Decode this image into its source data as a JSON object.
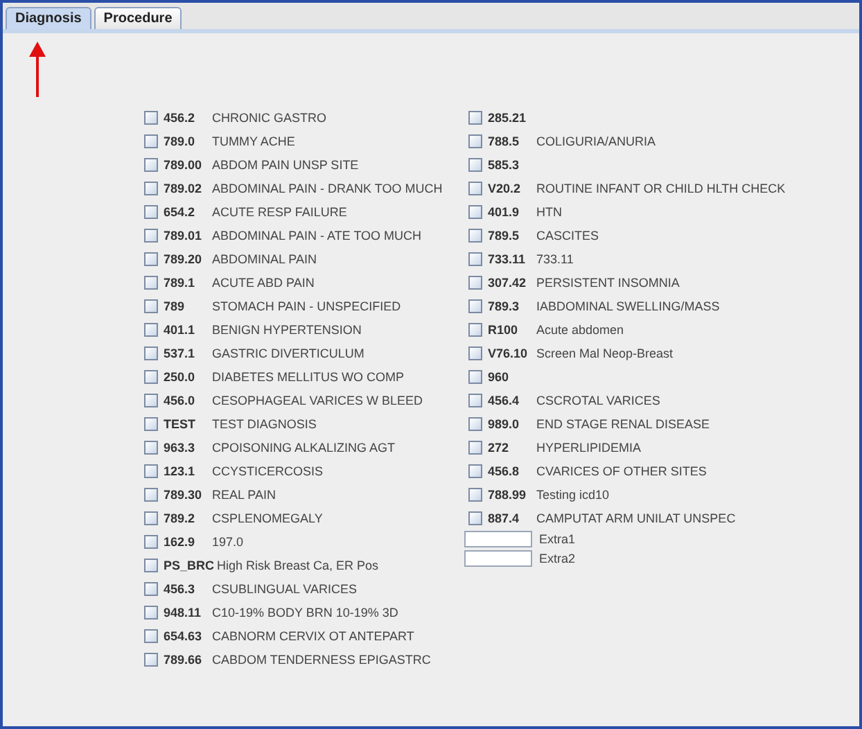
{
  "tabs": [
    {
      "label": "Diagnosis",
      "selected": true
    },
    {
      "label": "Procedure",
      "selected": false
    }
  ],
  "left_column": [
    {
      "code": "456.2",
      "description": "CHRONIC GASTRO",
      "checked": false
    },
    {
      "code": "789.0",
      "description": "TUMMY ACHE",
      "checked": false
    },
    {
      "code": "789.00",
      "description": "ABDOM PAIN UNSP SITE",
      "checked": false
    },
    {
      "code": "789.02",
      "description": "ABDOMINAL PAIN - DRANK TOO MUCH",
      "checked": false
    },
    {
      "code": "654.2",
      "description": "ACUTE RESP FAILURE",
      "checked": false
    },
    {
      "code": "789.01",
      "description": "ABDOMINAL PAIN - ATE TOO MUCH",
      "checked": false
    },
    {
      "code": "789.20",
      "description": "ABDOMINAL PAIN",
      "checked": false
    },
    {
      "code": "789.1",
      "description": "ACUTE ABD PAIN",
      "checked": false
    },
    {
      "code": "789",
      "description": "STOMACH PAIN - UNSPECIFIED",
      "checked": false
    },
    {
      "code": "401.1",
      "description": "BENIGN HYPERTENSION",
      "checked": false
    },
    {
      "code": "537.1",
      "description": "GASTRIC DIVERTICULUM",
      "checked": false
    },
    {
      "code": "250.0",
      "description": "DIABETES MELLITUS WO COMP",
      "checked": false
    },
    {
      "code": "456.0",
      "description": "CESOPHAGEAL VARICES W BLEED",
      "checked": false
    },
    {
      "code": "TEST",
      "description": "TEST DIAGNOSIS",
      "checked": false
    },
    {
      "code": "963.3",
      "description": "CPOISONING ALKALIZING AGT",
      "checked": false
    },
    {
      "code": "123.1",
      "description": "CCYSTICERCOSIS",
      "checked": false
    },
    {
      "code": "789.30",
      "description": "REAL PAIN",
      "checked": false
    },
    {
      "code": "789.2",
      "description": "CSPLENOMEGALY",
      "checked": false
    },
    {
      "code": "162.9",
      "description": "197.0",
      "checked": false
    },
    {
      "code": "PS_BRC",
      "description": "High Risk Breast Ca, ER Pos",
      "checked": false
    },
    {
      "code": "456.3",
      "description": "CSUBLINGUAL VARICES",
      "checked": false
    },
    {
      "code": "948.11",
      "description": "C10-19% BODY BRN 10-19% 3D",
      "checked": false
    },
    {
      "code": "654.63",
      "description": "CABNORM CERVIX OT ANTEPART",
      "checked": false
    },
    {
      "code": "789.66",
      "description": "CABDOM TENDERNESS EPIGASTRC",
      "checked": false
    }
  ],
  "right_column": [
    {
      "code": "285.21",
      "checked": false
    },
    {
      "code": "788.5",
      "description": "COLIGURIA/ANURIA",
      "checked": false
    },
    {
      "code": "585.3",
      "checked": false
    },
    {
      "code": "V20.2",
      "description": "ROUTINE INFANT OR CHILD HLTH CHECK",
      "checked": false
    },
    {
      "code": "401.9",
      "description": "HTN",
      "checked": false
    },
    {
      "code": "789.5",
      "description": "CASCITES",
      "checked": false
    },
    {
      "code": "733.11",
      "description": "733.11",
      "checked": false
    },
    {
      "code": "307.42",
      "description": "PERSISTENT INSOMNIA",
      "checked": false
    },
    {
      "code": "789.3",
      "description": "IABDOMINAL SWELLING/MASS",
      "checked": false
    },
    {
      "code": "R100",
      "description": "Acute abdomen",
      "checked": false
    },
    {
      "code": "V76.10",
      "description": "Screen Mal Neop-Breast",
      "checked": false
    },
    {
      "code": "960",
      "checked": false
    },
    {
      "code": "456.4",
      "description": "CSCROTAL VARICES",
      "checked": false
    },
    {
      "code": "989.0",
      "description": "END STAGE RENAL DISEASE",
      "checked": false
    },
    {
      "code": "272",
      "description": "HYPERLIPIDEMIA",
      "checked": false
    },
    {
      "code": "456.8",
      "description": "CVARICES OF OTHER SITES",
      "checked": false
    },
    {
      "code": "788.99",
      "description": "Testing icd10",
      "checked": false
    },
    {
      "code": "887.4",
      "description": "CAMPUTAT ARM UNILAT UNSPEC",
      "checked": false
    }
  ],
  "extra_fields": [
    {
      "label": "Extra1"
    },
    {
      "label": "Extra2"
    }
  ]
}
